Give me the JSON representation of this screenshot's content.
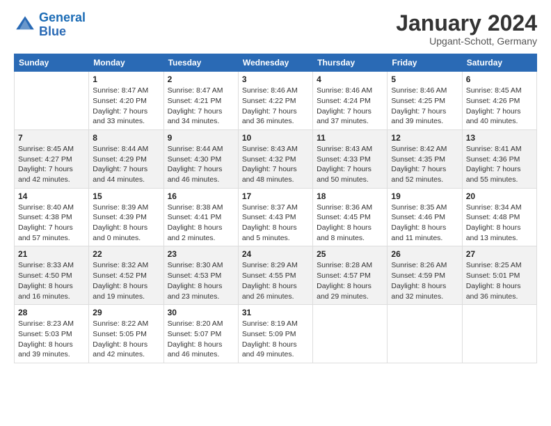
{
  "logo": {
    "line1": "General",
    "line2": "Blue"
  },
  "title": "January 2024",
  "subtitle": "Upgant-Schott, Germany",
  "days_header": [
    "Sunday",
    "Monday",
    "Tuesday",
    "Wednesday",
    "Thursday",
    "Friday",
    "Saturday"
  ],
  "weeks": [
    [
      {
        "day": "",
        "info": ""
      },
      {
        "day": "1",
        "info": "Sunrise: 8:47 AM\nSunset: 4:20 PM\nDaylight: 7 hours\nand 33 minutes."
      },
      {
        "day": "2",
        "info": "Sunrise: 8:47 AM\nSunset: 4:21 PM\nDaylight: 7 hours\nand 34 minutes."
      },
      {
        "day": "3",
        "info": "Sunrise: 8:46 AM\nSunset: 4:22 PM\nDaylight: 7 hours\nand 36 minutes."
      },
      {
        "day": "4",
        "info": "Sunrise: 8:46 AM\nSunset: 4:24 PM\nDaylight: 7 hours\nand 37 minutes."
      },
      {
        "day": "5",
        "info": "Sunrise: 8:46 AM\nSunset: 4:25 PM\nDaylight: 7 hours\nand 39 minutes."
      },
      {
        "day": "6",
        "info": "Sunrise: 8:45 AM\nSunset: 4:26 PM\nDaylight: 7 hours\nand 40 minutes."
      }
    ],
    [
      {
        "day": "7",
        "info": "Sunrise: 8:45 AM\nSunset: 4:27 PM\nDaylight: 7 hours\nand 42 minutes."
      },
      {
        "day": "8",
        "info": "Sunrise: 8:44 AM\nSunset: 4:29 PM\nDaylight: 7 hours\nand 44 minutes."
      },
      {
        "day": "9",
        "info": "Sunrise: 8:44 AM\nSunset: 4:30 PM\nDaylight: 7 hours\nand 46 minutes."
      },
      {
        "day": "10",
        "info": "Sunrise: 8:43 AM\nSunset: 4:32 PM\nDaylight: 7 hours\nand 48 minutes."
      },
      {
        "day": "11",
        "info": "Sunrise: 8:43 AM\nSunset: 4:33 PM\nDaylight: 7 hours\nand 50 minutes."
      },
      {
        "day": "12",
        "info": "Sunrise: 8:42 AM\nSunset: 4:35 PM\nDaylight: 7 hours\nand 52 minutes."
      },
      {
        "day": "13",
        "info": "Sunrise: 8:41 AM\nSunset: 4:36 PM\nDaylight: 7 hours\nand 55 minutes."
      }
    ],
    [
      {
        "day": "14",
        "info": "Sunrise: 8:40 AM\nSunset: 4:38 PM\nDaylight: 7 hours\nand 57 minutes."
      },
      {
        "day": "15",
        "info": "Sunrise: 8:39 AM\nSunset: 4:39 PM\nDaylight: 8 hours\nand 0 minutes."
      },
      {
        "day": "16",
        "info": "Sunrise: 8:38 AM\nSunset: 4:41 PM\nDaylight: 8 hours\nand 2 minutes."
      },
      {
        "day": "17",
        "info": "Sunrise: 8:37 AM\nSunset: 4:43 PM\nDaylight: 8 hours\nand 5 minutes."
      },
      {
        "day": "18",
        "info": "Sunrise: 8:36 AM\nSunset: 4:45 PM\nDaylight: 8 hours\nand 8 minutes."
      },
      {
        "day": "19",
        "info": "Sunrise: 8:35 AM\nSunset: 4:46 PM\nDaylight: 8 hours\nand 11 minutes."
      },
      {
        "day": "20",
        "info": "Sunrise: 8:34 AM\nSunset: 4:48 PM\nDaylight: 8 hours\nand 13 minutes."
      }
    ],
    [
      {
        "day": "21",
        "info": "Sunrise: 8:33 AM\nSunset: 4:50 PM\nDaylight: 8 hours\nand 16 minutes."
      },
      {
        "day": "22",
        "info": "Sunrise: 8:32 AM\nSunset: 4:52 PM\nDaylight: 8 hours\nand 19 minutes."
      },
      {
        "day": "23",
        "info": "Sunrise: 8:30 AM\nSunset: 4:53 PM\nDaylight: 8 hours\nand 23 minutes."
      },
      {
        "day": "24",
        "info": "Sunrise: 8:29 AM\nSunset: 4:55 PM\nDaylight: 8 hours\nand 26 minutes."
      },
      {
        "day": "25",
        "info": "Sunrise: 8:28 AM\nSunset: 4:57 PM\nDaylight: 8 hours\nand 29 minutes."
      },
      {
        "day": "26",
        "info": "Sunrise: 8:26 AM\nSunset: 4:59 PM\nDaylight: 8 hours\nand 32 minutes."
      },
      {
        "day": "27",
        "info": "Sunrise: 8:25 AM\nSunset: 5:01 PM\nDaylight: 8 hours\nand 36 minutes."
      }
    ],
    [
      {
        "day": "28",
        "info": "Sunrise: 8:23 AM\nSunset: 5:03 PM\nDaylight: 8 hours\nand 39 minutes."
      },
      {
        "day": "29",
        "info": "Sunrise: 8:22 AM\nSunset: 5:05 PM\nDaylight: 8 hours\nand 42 minutes."
      },
      {
        "day": "30",
        "info": "Sunrise: 8:20 AM\nSunset: 5:07 PM\nDaylight: 8 hours\nand 46 minutes."
      },
      {
        "day": "31",
        "info": "Sunrise: 8:19 AM\nSunset: 5:09 PM\nDaylight: 8 hours\nand 49 minutes."
      },
      {
        "day": "",
        "info": ""
      },
      {
        "day": "",
        "info": ""
      },
      {
        "day": "",
        "info": ""
      }
    ]
  ]
}
